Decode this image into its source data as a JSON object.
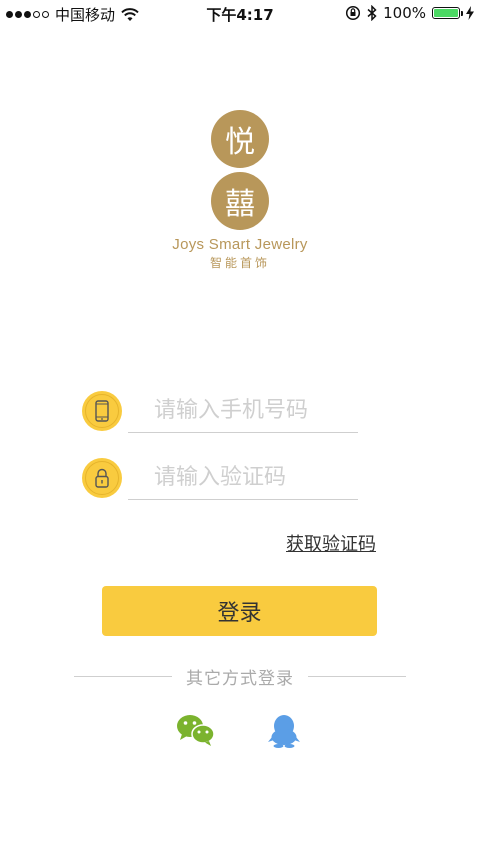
{
  "status_bar": {
    "carrier": "中国移动",
    "time": "下午4:17",
    "battery": "100%",
    "battery_color": "#4cd964",
    "icons": [
      "signal-dots-icon",
      "wifi-icon",
      "rotation-lock-icon",
      "bluetooth-icon",
      "battery-icon",
      "charging-icon"
    ]
  },
  "logo": {
    "char_top": "悦",
    "char_bottom": "囍",
    "en": "Joys Smart Jewelry",
    "cn": "智能首饰",
    "color": "#b8975a"
  },
  "form": {
    "phone_placeholder": "请输入手机号码",
    "phone_value": "",
    "code_placeholder": "请输入验证码",
    "code_value": "",
    "phone_icon": "phone-icon",
    "code_icon": "lock-icon",
    "get_code_label": "获取验证码",
    "login_label": "登录",
    "accent_color": "#f9cb3f"
  },
  "other_login": {
    "label": "其它方式登录",
    "options": [
      {
        "icon": "wechat-icon",
        "color": "#7bb32e"
      },
      {
        "icon": "qq-icon",
        "color": "#5b9ee6"
      }
    ]
  }
}
